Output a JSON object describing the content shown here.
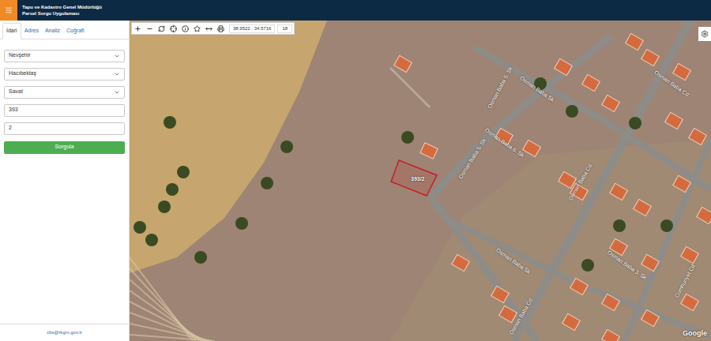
{
  "header": {
    "title": "Tapu ve Kadastro Genel Müdürlüğü",
    "subtitle": "Parsel Sorgu Uygulaması"
  },
  "tabs": [
    {
      "label": "İdari",
      "selected": true
    },
    {
      "label": "Adres",
      "selected": false
    },
    {
      "label": "Analiz",
      "selected": false
    },
    {
      "label": "Coğrafi",
      "selected": false
    }
  ],
  "form": {
    "fields": [
      {
        "kind": "select",
        "value": "Nevşehir"
      },
      {
        "kind": "select",
        "value": "Hacıbektaş"
      },
      {
        "kind": "select",
        "value": "Savat"
      },
      {
        "kind": "input",
        "value": "393"
      },
      {
        "kind": "input",
        "value": "2"
      }
    ],
    "button": "Sorgula"
  },
  "footer": {
    "email": "cbs@tkgm.gov.tr"
  },
  "toolbar": {
    "coordinates": "38.9522 : 34.5716",
    "zoom": "18"
  },
  "map": {
    "parcel": "393/2",
    "labels": [
      "Osman Baba 5. Sk",
      "Osman Baba Sk",
      "Osman Baba 6. Sk",
      "Osman Baba 5. Sk",
      "Osman Baba Cd",
      "Osman Baba Sk",
      "Osman Baba Cd",
      "Osman Baba 3. Sk",
      "Cumhuriyet Cd",
      "Osman Baba Cd"
    ],
    "attribution": "Google"
  }
}
